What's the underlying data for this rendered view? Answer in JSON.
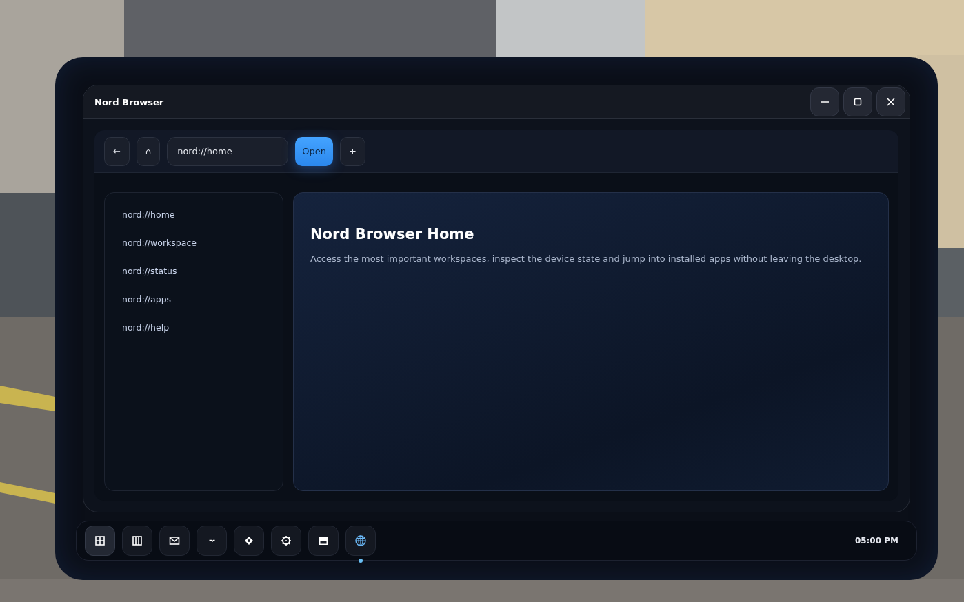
{
  "window": {
    "title": "Nord Browser"
  },
  "window_controls": [
    {
      "kind": "minimize"
    },
    {
      "kind": "maximize"
    },
    {
      "kind": "close"
    }
  ],
  "toolbar": {
    "back": "←",
    "home": "⌂",
    "address": "nord://home",
    "open": "Open",
    "new_tab": "+"
  },
  "sidebar": {
    "items": [
      {
        "label": "nord://home"
      },
      {
        "label": "nord://workspace"
      },
      {
        "label": "nord://status"
      },
      {
        "label": "nord://apps"
      },
      {
        "label": "nord://help"
      }
    ]
  },
  "page": {
    "heading": "Nord Browser Home",
    "text": "Access the most important workspaces, inspect the device state and jump into installed apps without leaving the desktop."
  },
  "dock": {
    "apps": [
      {
        "kind": "grid",
        "selected": true,
        "running": false
      },
      {
        "kind": "columns",
        "selected": false,
        "running": false
      },
      {
        "kind": "mail",
        "selected": false,
        "running": false
      },
      {
        "kind": "signal",
        "selected": false,
        "running": false
      },
      {
        "kind": "diamond",
        "selected": false,
        "running": false
      },
      {
        "kind": "gear",
        "selected": false,
        "running": false
      },
      {
        "kind": "window",
        "selected": false,
        "running": false
      },
      {
        "kind": "globe",
        "selected": false,
        "running": true
      }
    ],
    "clock": "05:00 PM"
  }
}
